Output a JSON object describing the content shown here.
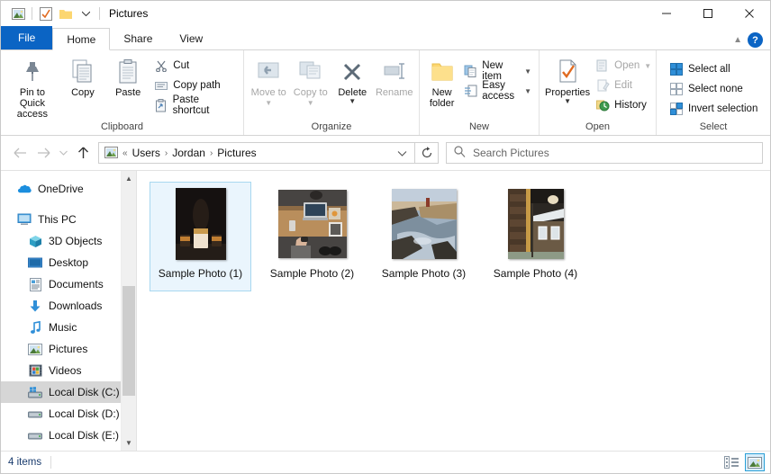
{
  "window": {
    "title": "Pictures",
    "quick_access": [
      "pictures-icon",
      "checklist-icon",
      "folder-icon",
      "dropdown-caret"
    ],
    "controls": {
      "minimize": "minimize-icon",
      "maximize": "maximize-icon",
      "close": "close-icon"
    }
  },
  "tabs": [
    {
      "label": "File",
      "active": false,
      "kind": "file"
    },
    {
      "label": "Home",
      "active": true,
      "kind": "normal"
    },
    {
      "label": "Share",
      "active": false,
      "kind": "normal"
    },
    {
      "label": "View",
      "active": false,
      "kind": "normal"
    }
  ],
  "ribbon_extra": {
    "collapse": "chevron-up-icon",
    "help": "?"
  },
  "ribbon": {
    "groups": [
      {
        "label": "Clipboard",
        "big": [
          {
            "label": "Pin to Quick access",
            "icon": "pin-icon",
            "disabled": false
          },
          {
            "label": "Copy",
            "icon": "copy-icon",
            "disabled": false
          },
          {
            "label": "Paste",
            "icon": "paste-icon",
            "disabled": false
          }
        ],
        "small": [
          {
            "label": "Cut",
            "icon": "scissors-icon",
            "disabled": false
          },
          {
            "label": "Copy path",
            "icon": "copy-path-icon",
            "disabled": false
          },
          {
            "label": "Paste shortcut",
            "icon": "paste-shortcut-icon",
            "disabled": false
          }
        ]
      },
      {
        "label": "Organize",
        "big": [
          {
            "label": "Move to",
            "icon": "move-to-icon",
            "disabled": true,
            "caret": true
          },
          {
            "label": "Copy to",
            "icon": "copy-to-icon",
            "disabled": true,
            "caret": true
          },
          {
            "label": "Delete",
            "icon": "delete-x-icon",
            "disabled": false,
            "caret": true
          },
          {
            "label": "Rename",
            "icon": "rename-icon",
            "disabled": true
          }
        ],
        "small": []
      },
      {
        "label": "New",
        "big": [
          {
            "label": "New folder",
            "icon": "new-folder-icon",
            "disabled": false
          }
        ],
        "small": [
          {
            "label": "New item",
            "icon": "new-item-icon",
            "disabled": false,
            "caret": true
          },
          {
            "label": "Easy access",
            "icon": "easy-access-icon",
            "disabled": false,
            "caret": true
          }
        ]
      },
      {
        "label": "Open",
        "big": [
          {
            "label": "Properties",
            "icon": "properties-icon",
            "disabled": false,
            "caret": true
          }
        ],
        "small": [
          {
            "label": "Open",
            "icon": "open-icon",
            "disabled": true,
            "caret": true
          },
          {
            "label": "Edit",
            "icon": "edit-icon",
            "disabled": true
          },
          {
            "label": "History",
            "icon": "history-icon",
            "disabled": false
          }
        ]
      },
      {
        "label": "Select",
        "big": [],
        "small": [
          {
            "label": "Select all",
            "icon": "select-all-icon",
            "disabled": false
          },
          {
            "label": "Select none",
            "icon": "select-none-icon",
            "disabled": false
          },
          {
            "label": "Invert selection",
            "icon": "invert-selection-icon",
            "disabled": false
          }
        ]
      }
    ]
  },
  "address": {
    "back": "back-arrow-icon",
    "forward": "forward-arrow-icon",
    "recent": "recent-caret-icon",
    "up": "up-arrow-icon",
    "path_icon": "pictures-icon",
    "overflow": "«",
    "crumbs": [
      "Users",
      "Jordan",
      "Pictures"
    ],
    "separator": "›",
    "dropdown": "chevron-down-icon",
    "refresh": "refresh-icon"
  },
  "search": {
    "icon": "search-icon",
    "placeholder": "Search Pictures",
    "value": ""
  },
  "sidebar": {
    "items": [
      {
        "label": "OneDrive",
        "icon": "onedrive-cloud-icon",
        "indent": false,
        "selected": false
      },
      {
        "label": "This PC",
        "icon": "this-pc-icon",
        "indent": false,
        "selected": false
      },
      {
        "label": "3D Objects",
        "icon": "3d-objects-icon",
        "indent": true,
        "selected": false
      },
      {
        "label": "Desktop",
        "icon": "desktop-icon",
        "indent": true,
        "selected": false
      },
      {
        "label": "Documents",
        "icon": "documents-icon",
        "indent": true,
        "selected": false
      },
      {
        "label": "Downloads",
        "icon": "downloads-icon",
        "indent": true,
        "selected": false
      },
      {
        "label": "Music",
        "icon": "music-icon",
        "indent": true,
        "selected": false
      },
      {
        "label": "Pictures",
        "icon": "pictures-icon",
        "indent": true,
        "selected": false
      },
      {
        "label": "Videos",
        "icon": "videos-icon",
        "indent": true,
        "selected": false
      },
      {
        "label": "Local Disk (C:)",
        "icon": "system-drive-icon",
        "indent": true,
        "selected": true
      },
      {
        "label": "Local Disk (D:)",
        "icon": "drive-icon",
        "indent": true,
        "selected": false
      },
      {
        "label": "Local Disk (E:)",
        "icon": "drive-icon",
        "indent": true,
        "selected": false
      }
    ],
    "scroll": {
      "up": "scroll-up-icon",
      "down": "scroll-down-icon"
    }
  },
  "files": [
    {
      "name": "Sample Photo (1)",
      "selected": true,
      "kind": "dark-still-life"
    },
    {
      "name": "Sample Photo (2)",
      "selected": false,
      "kind": "desk-overhead"
    },
    {
      "name": "Sample Photo (3)",
      "selected": false,
      "kind": "coastal-cliff"
    },
    {
      "name": "Sample Photo (4)",
      "selected": false,
      "kind": "wooden-cabin"
    }
  ],
  "status": {
    "count": "4 items",
    "views": [
      {
        "name": "details-view",
        "active": false
      },
      {
        "name": "large-icons-view",
        "active": true
      }
    ]
  }
}
